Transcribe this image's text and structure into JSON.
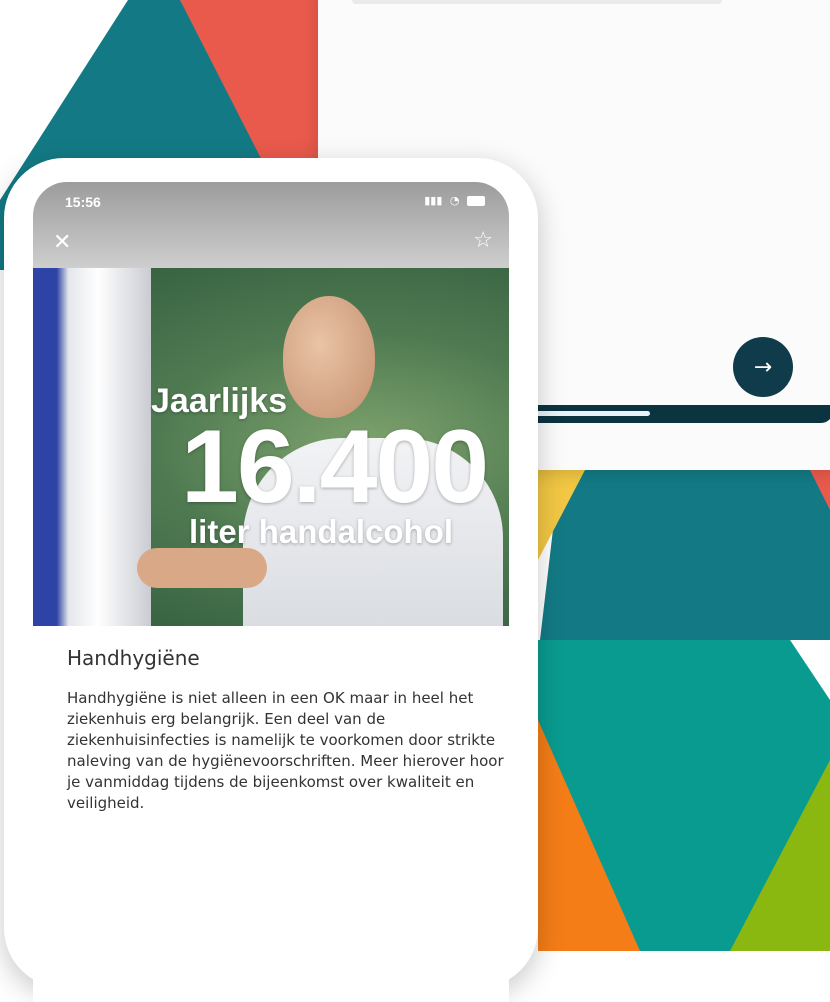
{
  "colors": {
    "teal": "#137a85",
    "coral": "#e95a4c",
    "dark_navy": "#0f3b4a",
    "yellow": "#f2c744",
    "green_teal": "#0a9b90",
    "orange": "#f47d17",
    "lime": "#8ab810"
  },
  "status_bar": {
    "time": "15:56",
    "signal_icon": "signal-icon",
    "wifi_icon": "wifi-icon",
    "battery_icon": "battery-icon"
  },
  "toolbar": {
    "close_icon": "✕",
    "favorite_icon": "☆"
  },
  "hero": {
    "line1": "Jaarlijks",
    "number": "16.400",
    "line3": "liter handalcohol"
  },
  "article": {
    "title": "Handhygiëne",
    "body": "Handhygiëne is niet alleen in een OK maar in heel het ziekenhuis erg belangrijk. Een deel van de ziekenhuisinfecties is namelijk te voorkomen door strikte naleving van de hygiënevoorschriften. Meer hierover hoor je vanmiddag tijdens de bijeenkomst over kwaliteit en veiligheid."
  },
  "back_card": {
    "next_icon": "→",
    "progress": 0.42
  }
}
